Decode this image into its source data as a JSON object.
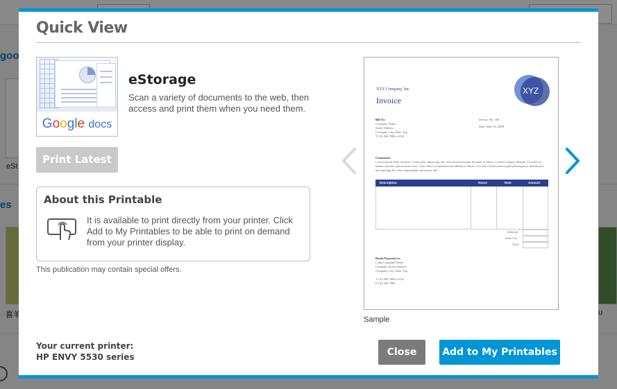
{
  "modal": {
    "title": "Quick View",
    "app_name": "eStorage",
    "app_description": "Scan a variety of documents to the web, then access and print them when you need them.",
    "thumbnail": {
      "logo_google": [
        "G",
        "o",
        "o",
        "g",
        "l",
        "e"
      ],
      "logo_docs": "docs"
    },
    "print_latest_label": "Print Latest",
    "about": {
      "title": "About this Printable",
      "text": "It is available to print directly from your printer. Click Add to My Printables to be able to print on demand from your printer display."
    },
    "offers_note": "This publication may contain special offers.",
    "printer": {
      "label": "Your current printer:",
      "name": "HP ENVY 5530 series"
    },
    "close_label": "Close",
    "add_label": "Add to My Printables",
    "sample_label": "Sample",
    "invoice": {
      "company": "XYZ Company, Inc.",
      "title": "Invoice",
      "logo": "XYZ",
      "bill_to_label": "Bill To:",
      "bill_to_lines": [
        "Company Name",
        "Street Address",
        "Company City, State, Zip",
        "T 123 456 7890 x1234"
      ],
      "service_no": "Service No: 100",
      "date": "Date: May 16, 2008",
      "comments_label": "Comments:",
      "comments_text": "Lorem ipsum dolor sit amet, consectetur adipiscing elit, sed eiusmod tempor incidunt ut labore et dolore magna aliquam. Ut enim ad minim veniam, quis nostrud exerc. Irure dolor in reprehend incididunt ut labore. Ut's have lasted tenetur glen prodesque no Itthollsued, nisi quid pig lie color suspenstable nd tenetor tale.",
      "columns": [
        "Description",
        "Hours",
        "Rate",
        "Amount"
      ],
      "totals": [
        "Subtotal",
        "Sales Tax",
        "Total"
      ],
      "remit_label": "Remit Payment to:",
      "remit_lines": [
        "Long Company Name",
        "Company Street Address",
        "Company City, State, Zip",
        "",
        "T 123 456 7890 x1234",
        "F 123 456 7899"
      ]
    },
    "colors": {
      "accent": "#0096d6",
      "close_bg": "#7b7b7b",
      "disabled": "#c9c9c9",
      "invoice_blue": "#2a3f8f"
    }
  },
  "background": {
    "heading_left": "goo",
    "tile_caption": "eSt",
    "heading_2": "es",
    "caption_2": "喜羊",
    "caption_3": "u"
  }
}
